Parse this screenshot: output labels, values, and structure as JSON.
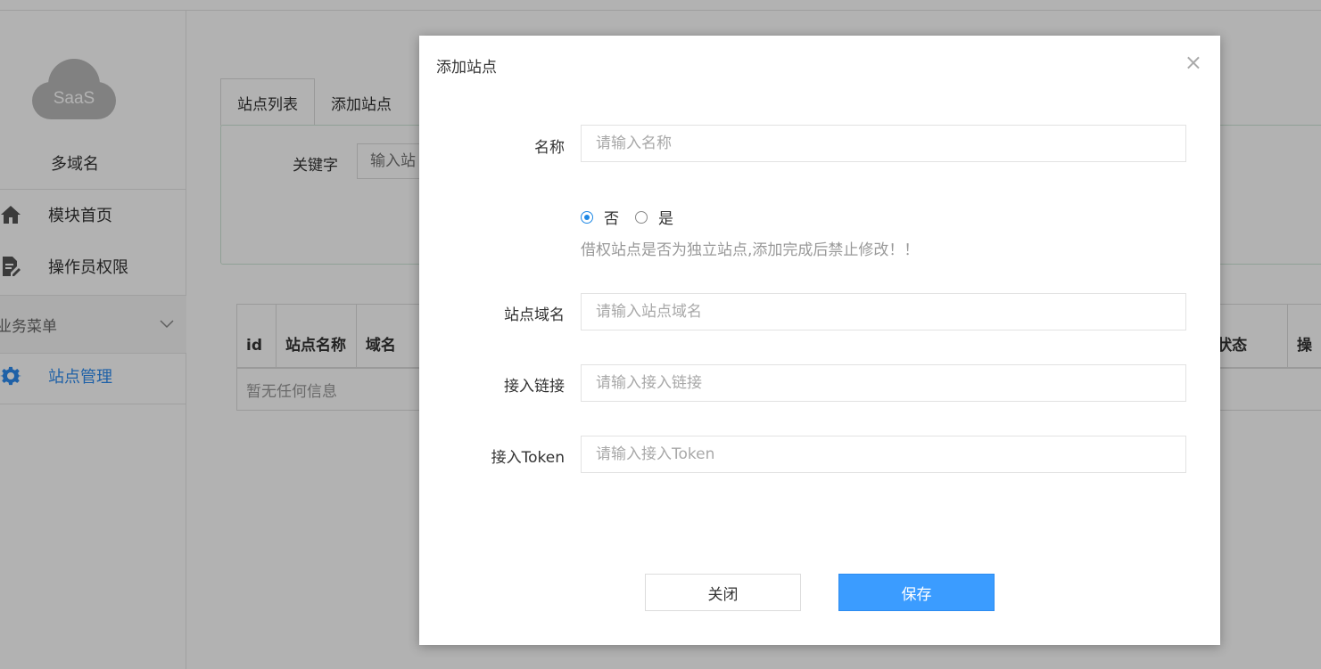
{
  "sidebar": {
    "logo_text": "SaaS",
    "site_name": "多域名",
    "items": [
      {
        "label": "模块首页",
        "icon": "home-icon"
      },
      {
        "label": "操作员权限",
        "icon": "document-edit-icon"
      }
    ],
    "group_title": "业务菜单",
    "group_items": [
      {
        "label": "站点管理",
        "icon": "gear-icon",
        "active": true
      }
    ]
  },
  "main": {
    "tabs": [
      "站点列表",
      "添加站点"
    ],
    "search": {
      "label": "关键字",
      "placeholder": "输入站"
    },
    "table": {
      "headers": [
        "id",
        "站点名称",
        "域名",
        "状态",
        "操"
      ],
      "empty_text": "暂无任何信息"
    }
  },
  "modal": {
    "title": "添加站点",
    "close_glyph": "×",
    "fields": {
      "name": {
        "label": "名称",
        "placeholder": "请输入名称"
      },
      "domain": {
        "label": "站点域名",
        "placeholder": "请输入站点域名"
      },
      "link": {
        "label": "接入链接",
        "placeholder": "请输入接入链接"
      },
      "token": {
        "label": "接入Token",
        "placeholder": "请输入接入Token"
      }
    },
    "radio": {
      "options": [
        "否",
        "是"
      ],
      "selected": "否",
      "hint": "借权站点是否为独立站点,添加完成后禁止修改！！"
    },
    "buttons": {
      "close": "关闭",
      "save": "保存"
    }
  },
  "colors": {
    "accent": "#3b9cff",
    "active_nav": "#2d8cf0",
    "radio": "#1e88e5"
  }
}
